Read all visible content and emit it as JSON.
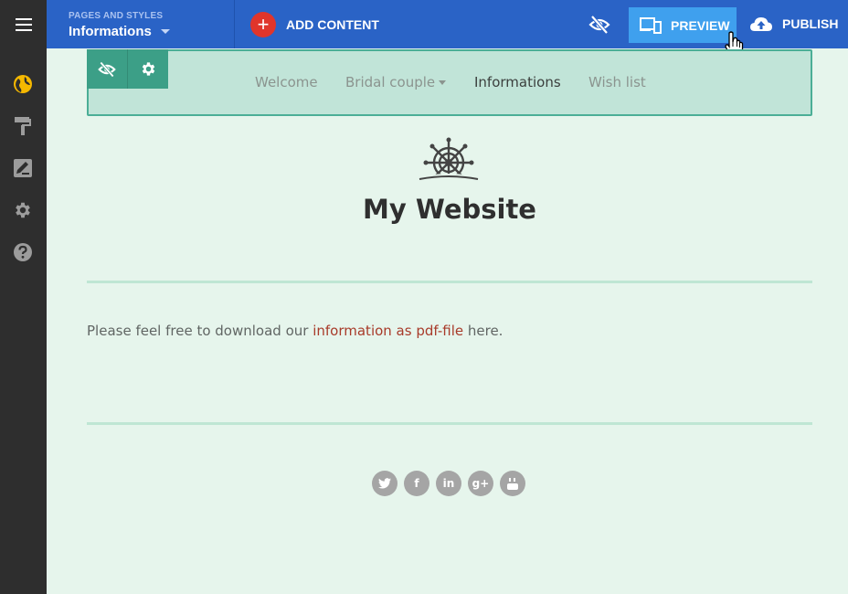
{
  "topbar": {
    "pages_caption": "PAGES AND STYLES",
    "pages_selected": "Informations",
    "add_content_label": "ADD CONTENT",
    "preview_label": "PREVIEW",
    "publish_label": "PUBLISH"
  },
  "sidebar": {
    "icons": [
      "menu-icon",
      "globe-icon",
      "paint-roller-icon",
      "edit-icon",
      "gear-icon",
      "help-icon"
    ]
  },
  "site": {
    "nav": [
      {
        "label": "Welcome"
      },
      {
        "label": "Bridal couple"
      },
      {
        "label": "Informations"
      },
      {
        "label": "Wish list"
      }
    ],
    "title": "My Website",
    "paragraph": {
      "before": "Please feel free to download our ",
      "link": "information as pdf-file",
      "after": " here."
    },
    "social": {
      "twitter": "",
      "facebook": "f",
      "linkedin": "in",
      "googleplus": "g+",
      "youtube": ""
    }
  },
  "colors": {
    "topbar": "#2a63c6",
    "rail": "#2e2e2e",
    "preview_button": "#3fa0ee",
    "add_button": "#e0352b",
    "page_bg": "#e6f5ec",
    "link": "#a83b2a",
    "globe_active": "#f5b800"
  }
}
